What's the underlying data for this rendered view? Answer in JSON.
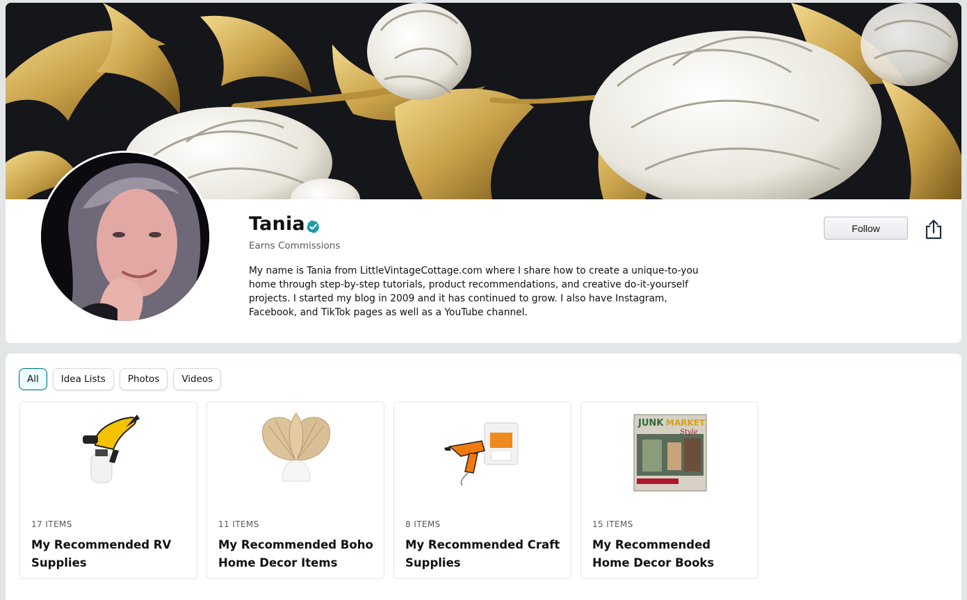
{
  "profile": {
    "name": "Tania",
    "earns": "Earns Commissions",
    "bio": "My name is Tania from LittleVintageCottage.com where I share how to create a unique-to-you home through step-by-step tutorials, product recommendations, and creative do-it-yourself projects. I started my blog in 2009 and it has continued to grow. I also have Instagram, Facebook, and TikTok pages as well as a YouTube channel.",
    "follow_label": "Follow",
    "icons": {
      "verified": "verified-check-icon",
      "share": "share-icon"
    },
    "colors": {
      "verified": "#1e9ba8",
      "banner_bg": "#14161a",
      "gold": "#c9a24a"
    }
  },
  "filters": {
    "tabs": [
      {
        "label": "All",
        "active": true
      },
      {
        "label": "Idea Lists",
        "active": false
      },
      {
        "label": "Photos",
        "active": false
      },
      {
        "label": "Videos",
        "active": false
      }
    ]
  },
  "idea_lists": [
    {
      "count": "17 ITEMS",
      "title": "My Recommended RV Supplies",
      "thumb": "paint-sprayer"
    },
    {
      "count": "11 ITEMS",
      "title": "My Recommended Boho Home Decor Items",
      "thumb": "palm-leaf-decor"
    },
    {
      "count": "8 ITEMS",
      "title": "My Recommended Craft Supplies",
      "thumb": "glue-gun"
    },
    {
      "count": "15 ITEMS",
      "title": "My Recommended Home Decor Books",
      "thumb": "junk-market-book"
    }
  ],
  "book_cover": {
    "line1": "JUNK",
    "line2": "MARKET",
    "line3": "Style"
  }
}
